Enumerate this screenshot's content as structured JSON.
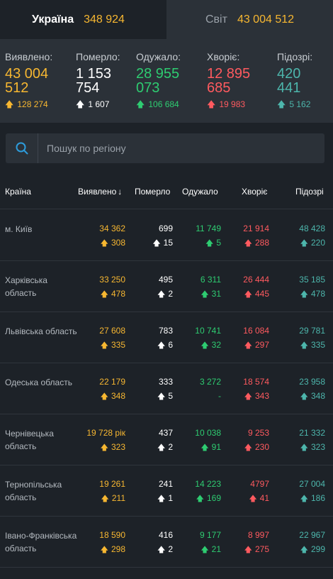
{
  "tabs": {
    "ukraine": {
      "label": "Україна",
      "value": "348 924"
    },
    "world": {
      "label": "Світ",
      "value": "43 004 512"
    }
  },
  "summary": {
    "confirmed": {
      "label": "Виявлено:",
      "line1": "43 004",
      "line2": "512",
      "delta": "128 274"
    },
    "deaths": {
      "label": "Померло:",
      "line1": "1 153",
      "line2": "754",
      "delta": "1 607"
    },
    "recovered": {
      "label": "Одужало:",
      "line1": "28 955",
      "line2": "073",
      "delta": "106 684"
    },
    "sick": {
      "label": "Хворіє:",
      "line1": "12 895",
      "line2": "685",
      "delta": "19 983"
    },
    "suspected": {
      "label": "Підозрі:",
      "line1": "420",
      "line2": "441",
      "delta": "5 162"
    }
  },
  "search": {
    "placeholder": "Пошук по регіону"
  },
  "table": {
    "headers": {
      "country": "Країна",
      "confirmed": "Виявлено",
      "sort_arrow": "↓",
      "deaths": "Померло",
      "recovered": "Одужало",
      "sick": "Хворіє",
      "suspected": "Підозрі"
    },
    "rows": [
      {
        "region": "м. Київ",
        "confirmed": "34 362",
        "confirmed_d": "308",
        "deaths": "699",
        "deaths_d": "15",
        "recovered": "11 749",
        "recovered_d": "5",
        "sick": "21 914",
        "sick_d": "288",
        "suspected": "48 428",
        "suspected_d": "220"
      },
      {
        "region": "Харківська область",
        "confirmed": "33 250",
        "confirmed_d": "478",
        "deaths": "495",
        "deaths_d": "2",
        "recovered": "6 311",
        "recovered_d": "31",
        "sick": "26 444",
        "sick_d": "445",
        "suspected": "35 185",
        "suspected_d": "478"
      },
      {
        "region": "Львівська область",
        "confirmed": "27 608",
        "confirmed_d": "335",
        "deaths": "783",
        "deaths_d": "6",
        "recovered": "10 741",
        "recovered_d": "32",
        "sick": "16 084",
        "sick_d": "297",
        "suspected": "29 781",
        "suspected_d": "335"
      },
      {
        "region": "Одеська область",
        "confirmed": "22 179",
        "confirmed_d": "348",
        "deaths": "333",
        "deaths_d": "5",
        "recovered": "3 272",
        "recovered_d": "-",
        "sick": "18 574",
        "sick_d": "343",
        "suspected": "23 958",
        "suspected_d": "348"
      },
      {
        "region": "Чернівецька область",
        "confirmed": "19 728 рік",
        "confirmed_d": "323",
        "deaths": "437",
        "deaths_d": "2",
        "recovered": "10 038",
        "recovered_d": "91",
        "sick": "9 253",
        "sick_d": "230",
        "suspected": "21 332",
        "suspected_d": "323"
      },
      {
        "region": "Тернопільська область",
        "confirmed": "19 261",
        "confirmed_d": "211",
        "deaths": "241",
        "deaths_d": "1",
        "recovered": "14 223",
        "recovered_d": "169",
        "sick": "4797",
        "sick_d": "41",
        "suspected": "27 004",
        "suspected_d": "186"
      },
      {
        "region": "Івано-Франківська область",
        "confirmed": "18 590",
        "confirmed_d": "298",
        "deaths": "416",
        "deaths_d": "2",
        "recovered": "9 177",
        "recovered_d": "21",
        "sick": "8 997",
        "sick_d": "275",
        "suspected": "22 967",
        "suspected_d": "299"
      }
    ]
  },
  "colors": {
    "background": "#1d2228",
    "panel": "#2b3138",
    "confirmed": "#f7b731",
    "deaths": "#ffffff",
    "recovered": "#2ecc71",
    "sick": "#ff5a5f",
    "suspected": "#4db6ac",
    "search_icon": "#2d9cdb"
  },
  "icons": {
    "search": "search-icon",
    "up_arrow": "arrow-up-icon"
  }
}
